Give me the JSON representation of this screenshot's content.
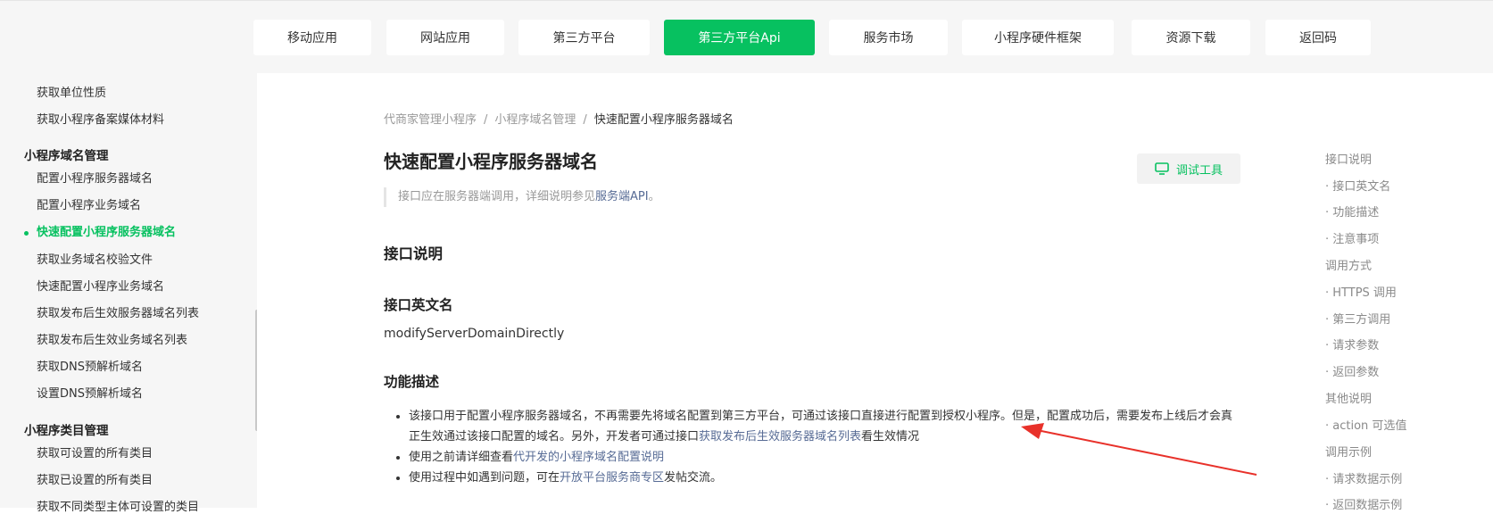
{
  "nav": {
    "tabs": [
      {
        "label": "移动应用"
      },
      {
        "label": "网站应用"
      },
      {
        "label": "第三方平台"
      },
      {
        "label": "第三方平台Api"
      },
      {
        "label": "服务市场"
      },
      {
        "label": "小程序硬件框架"
      },
      {
        "label": "资源下载"
      },
      {
        "label": "返回码"
      }
    ],
    "active_index": 3,
    "accent_color": "#07c160"
  },
  "sidebar": {
    "items": [
      {
        "label": "获取单位性质"
      },
      {
        "label": "获取小程序备案媒体材料"
      },
      {
        "label": "小程序域名管理"
      },
      {
        "label": "配置小程序服务器域名"
      },
      {
        "label": "配置小程序业务域名"
      },
      {
        "label": "快速配置小程序服务器域名"
      },
      {
        "label": "获取业务域名校验文件"
      },
      {
        "label": "快速配置小程序业务域名"
      },
      {
        "label": "获取发布后生效服务器域名列表"
      },
      {
        "label": "获取发布后生效业务域名列表"
      },
      {
        "label": "获取DNS预解析域名"
      },
      {
        "label": "设置DNS预解析域名"
      },
      {
        "label": "小程序类目管理"
      },
      {
        "label": "获取可设置的所有类目"
      },
      {
        "label": "获取已设置的所有类目"
      },
      {
        "label": "获取不同类型主体可设置的类目"
      }
    ]
  },
  "main": {
    "breadcrumb": {
      "parts": [
        "代商家管理小程序",
        "小程序域名管理",
        "快速配置小程序服务器域名"
      ],
      "separator": "/"
    },
    "title": "快速配置小程序服务器域名",
    "debug_button": "调试工具",
    "notice": {
      "prefix": "接口应在服务器端调用，详细说明参见",
      "link": "服务端API",
      "suffix": "。"
    },
    "section_interface": "接口说明",
    "section_english_name": "接口英文名",
    "english_name": "modifyServerDomainDirectly",
    "section_function": "功能描述",
    "bullets": [
      {
        "text1": "该接口用于配置小程序服务器域名，不再需要先将域名配置到第三方平台，可通过该接口直接进行配置到授权小程序。但是，配置成功后，需要发布上线后才会真正生效通过该接口配置的域名。另外，开发者可通过接口",
        "link": "获取发布后生效服务器域名列表",
        "text2": "看生效情况"
      },
      {
        "text1": "使用之前请详细查看",
        "link": "代开发的小程序域名配置说明",
        "text2": ""
      },
      {
        "text1": "使用过程中如遇到问题，可在",
        "link": "开放平台服务商专区",
        "text2": "发帖交流。"
      }
    ]
  },
  "toc": {
    "items": [
      {
        "label": "接口说明"
      },
      {
        "label": "· 接口英文名"
      },
      {
        "label": "· 功能描述"
      },
      {
        "label": "· 注意事项"
      },
      {
        "label": "调用方式"
      },
      {
        "label": "· HTTPS 调用"
      },
      {
        "label": "· 第三方调用"
      },
      {
        "label": "· 请求参数"
      },
      {
        "label": "· 返回参数"
      },
      {
        "label": "其他说明"
      },
      {
        "label": "· action 可选值"
      },
      {
        "label": "调用示例"
      },
      {
        "label": "· 请求数据示例"
      },
      {
        "label": "· 返回数据示例"
      }
    ]
  },
  "colors": {
    "accent": "#07c160",
    "link": "#576b95",
    "annotation_arrow": "#e8312a"
  }
}
